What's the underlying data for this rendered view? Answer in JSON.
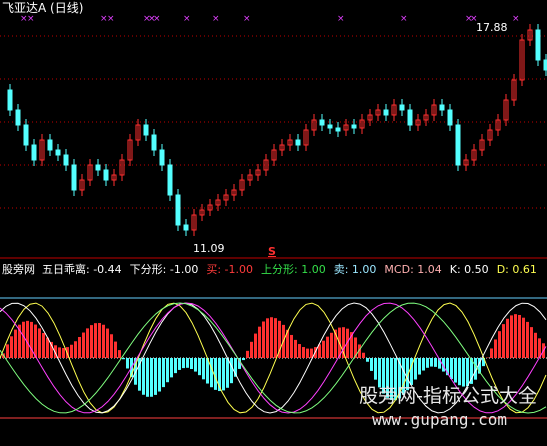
{
  "top_panel": {
    "title": "飞亚达A (日线)",
    "high_label": "17.88",
    "low_label": "11.09"
  },
  "signal_marker": "S",
  "indicator_bar": {
    "name": "股旁网",
    "items": [
      {
        "label": "五日乖离:",
        "value": "-0.44",
        "color": "#ffffff"
      },
      {
        "label": "下分形:",
        "value": "-1.00",
        "color": "#ffffff"
      },
      {
        "label": "买:",
        "value": "-1.00",
        "color": "#ff3b3b"
      },
      {
        "label": "上分形:",
        "value": "1.00",
        "color": "#35e04a"
      },
      {
        "label": "卖:",
        "value": "1.00",
        "color": "#9be7ff"
      },
      {
        "label": "MCD:",
        "value": "1.04",
        "color": "#ffb0b0"
      },
      {
        "label": "K:",
        "value": "0.50",
        "color": "#ffffff"
      },
      {
        "label": "D:",
        "value": "0.61",
        "color": "#ffff50"
      }
    ]
  },
  "watermark": {
    "text": "股旁网-指标公式大全",
    "url": "www.gupang.com"
  },
  "colors": {
    "up": "#ff3030",
    "down": "#54ffff",
    "marker": "#e040ff",
    "grid": "#c00000",
    "level": "#66d0ff"
  }
}
